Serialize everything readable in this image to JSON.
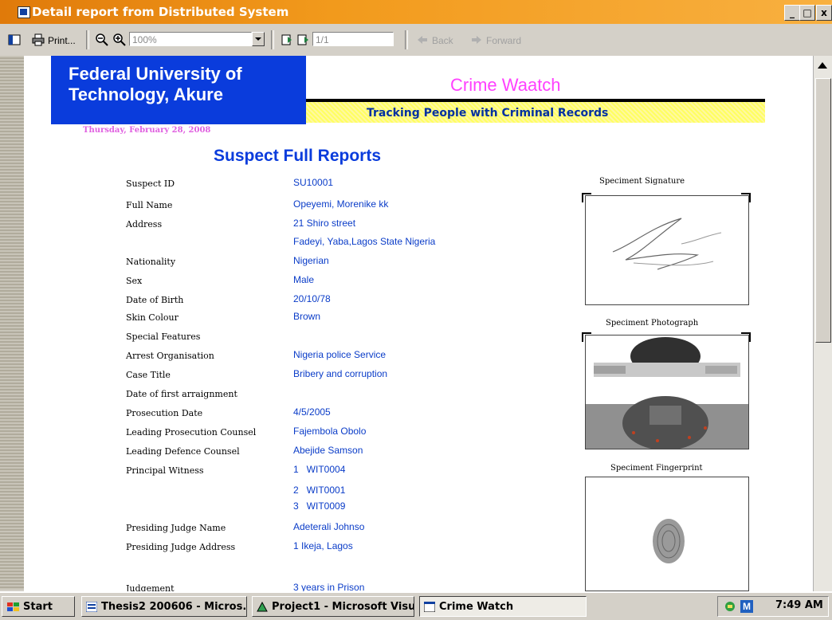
{
  "window": {
    "title": "Detail report from Distributed System",
    "controls": [
      "_",
      "□",
      "x"
    ]
  },
  "toolbar": {
    "print_label": "Print...",
    "zoom_value": "100%",
    "page_value": "1/1",
    "back_label": "Back",
    "forward_label": "Forward"
  },
  "report": {
    "university": [
      "Federal University of",
      "Technology, Akure"
    ],
    "app_title": "Crime Waatch",
    "tagline": "Tracking People with Criminal Records",
    "date": "Thursday, February 28, 2008",
    "title": "Suspect Full Reports",
    "fields": [
      {
        "label": "Suspect ID",
        "value": "SU10001"
      },
      {
        "label": "Full Name",
        "value": "Opeyemi, Morenike kk"
      },
      {
        "label": "Address",
        "value": "21 Shiro street"
      },
      {
        "label": "",
        "value": "Fadeyi, Yaba,Lagos State Nigeria"
      },
      {
        "label": "Nationality",
        "value": "Nigerian"
      },
      {
        "label": "Sex",
        "value": "Male"
      },
      {
        "label": "Date of Birth",
        "value": "20/10/78"
      },
      {
        "label": "Skin Colour",
        "value": "Brown"
      },
      {
        "label": "Special Features",
        "value": ""
      },
      {
        "label": "Arrest Organisation",
        "value": "Nigeria police Service"
      },
      {
        "label": "Case Title",
        "value": "Bribery and corruption"
      },
      {
        "label": "Date of first arraignment",
        "value": ""
      },
      {
        "label": "Prosecution Date",
        "value": "4/5/2005"
      },
      {
        "label": "Leading Prosecution Counsel",
        "value": "Fajembola Obolo"
      },
      {
        "label": "Leading Defence Counsel",
        "value": "Abejide Samson"
      },
      {
        "label": "Principal Witness",
        "value": "1   WIT0004"
      },
      {
        "label": "",
        "value": "2   WIT0001"
      },
      {
        "label": "",
        "value": "3   WIT0009"
      },
      {
        "label": "Presiding Judge Name",
        "value": "Adeterali Johnso"
      },
      {
        "label": "Presiding Judge Address",
        "value": "1 Ikeja, Lagos"
      },
      {
        "label": "Judgement",
        "value": "3 years in Prison"
      }
    ],
    "specimens": {
      "signature": "Speciment Signature",
      "photograph": "Speciment Photograph",
      "fingerprint": "Speciment Fingerprint"
    }
  },
  "taskbar": {
    "start": "Start",
    "items": [
      "Thesis2 200606 - Micros...",
      "Project1 - Microsoft Visu...",
      "Crime Watch"
    ],
    "tray_badge": "M",
    "clock": "7:49 AM"
  }
}
